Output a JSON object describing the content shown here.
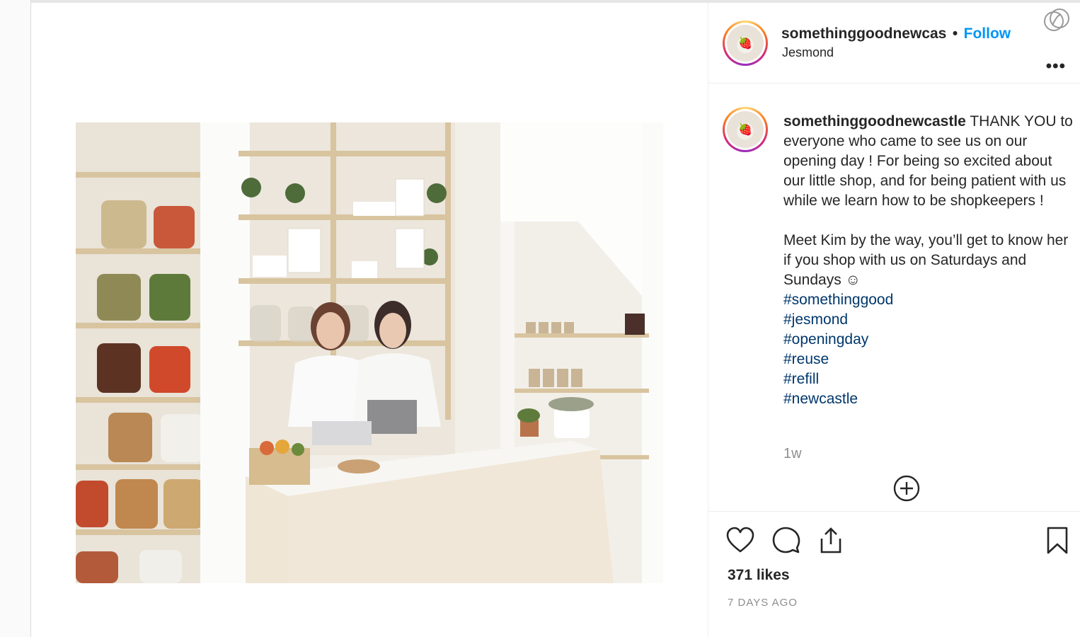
{
  "post": {
    "username": "somethinggoodnewcas",
    "separator": "•",
    "follow_label": "Follow",
    "location": "Jesmond",
    "more_label": "•••",
    "caption": {
      "username": "somethinggoodnewcastle",
      "text_p1": "THANK YOU to everyone who came to see us on our opening day ! For being so excited about our little shop, and for being patient with us while we learn how to be shopkeepers !",
      "text_p2": "Meet Kim by the way, you’ll get to know her if you shop with us on Saturdays and Sundays ☺",
      "hashtags": [
        "#somethinggood",
        "#jesmond",
        "#openingday",
        "#reuse",
        "#refill",
        "#newcastle"
      ],
      "age": "1w"
    },
    "likes": "371 likes",
    "posted": "7 DAYS AGO"
  },
  "icons": {
    "like": "heart-icon",
    "comment": "comment-icon",
    "share": "share-icon",
    "save": "bookmark-icon",
    "load_more": "plus-circle-icon",
    "more": "more-options-icon",
    "extension": "extension-icon"
  },
  "colors": {
    "follow": "#0095f6",
    "hashtag": "#00376b",
    "muted": "#8e8e8e"
  }
}
